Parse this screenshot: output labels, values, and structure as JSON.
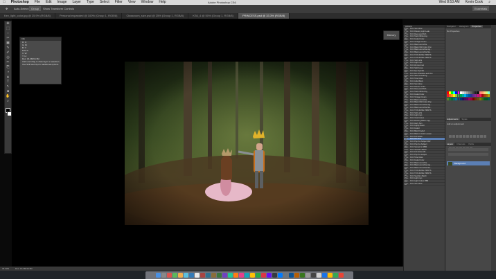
{
  "menubar": {
    "apple": "",
    "items": [
      "Photoshop",
      "File",
      "Edit",
      "Image",
      "Layer",
      "Type",
      "Select",
      "Filter",
      "View",
      "Window",
      "Help"
    ],
    "title": "Adobe Photoshop CS6",
    "clock": "Wed 8:53 AM",
    "user": "Kevin Cook"
  },
  "options": {
    "auto_select": "Auto-Select:",
    "group": "Group",
    "show_transform": "Show Transform Controls",
    "workspace": "Essentials"
  },
  "tabs": [
    {
      "label": "Kev_light_color.jpg @ 25.9% (RGB/8)",
      "active": false
    },
    {
      "label": "Personal expanded @ 100% (Group 1, RGB/8)",
      "active": false
    },
    {
      "label": "Classroom_size.psd @ 25% (Group 1, RGB/8)",
      "active": false
    },
    {
      "label": "KS6_4 @ 50% (Group 1, RGB/8)",
      "active": false
    },
    {
      "label": "PRINCESS.psd @ 33.3% (RGB/8)",
      "active": true
    }
  ],
  "tools": [
    "✚",
    "⬚",
    "◌",
    "✂",
    "▣",
    "✎",
    "✐",
    "◎",
    "✏",
    "⎘",
    "◑",
    "▲",
    "T",
    "↖",
    "■",
    "✋",
    "⌕"
  ],
  "info_panel": {
    "title": "Info",
    "rows": [
      "R:        C:",
      "G:        M:",
      "B:        Y:",
      "8-bit     K:",
      "X:        W:",
      "Y:        H:",
      "Doc: 16.3M/16.3M",
      "Click and drag to draw layer or selection.",
      "Use Shift and Opt for additional options."
    ]
  },
  "memory_button": "Memory",
  "status": {
    "zoom": "33.33%",
    "doc": "Doc: 16.3M/16.3M"
  },
  "actions_panel": {
    "title": "Actions",
    "rows": [
      {
        "label": "KCC Sun Glow",
        "sel": false
      },
      {
        "label": "KCC Dreamy Light Leak",
        "sel": false
      },
      {
        "label": "KCC Deep and Rich",
        "sel": false
      },
      {
        "label": "KCC Teeth Whitening",
        "sel": false
      },
      {
        "label": "KCC Faded Color",
        "sel": false
      },
      {
        "label": "KCC Vintage Cream",
        "sel": false
      },
      {
        "label": "KCC Black and white",
        "sel": false
      },
      {
        "label": "KCC Black With Color Pop",
        "sel": false
      },
      {
        "label": "KCC Black and white Hig...",
        "sel": false
      },
      {
        "label": "KCC Black and white Ma...",
        "sel": false
      },
      {
        "label": "KCC TR B-RUSH PRINTS",
        "sel": false
      },
      {
        "label": "KCC TR B-RUSH PRINTS",
        "sel": false
      },
      {
        "label": "KCC Soft Light",
        "sel": false
      },
      {
        "label": "KCC Light rays",
        "sel": false
      },
      {
        "label": "KCC All one level",
        "sel": false
      },
      {
        "label": "KCC Soft Focus",
        "sel": false
      },
      {
        "label": "KCC Eye Sparkle",
        "sel": false
      },
      {
        "label": "KCC Eye Shadows and Pop",
        "sel": false
      },
      {
        "label": "KCC Skin Smoothing",
        "sel": false
      },
      {
        "label": "KCC Tone Glow",
        "sel": false
      },
      {
        "label": "KCC Little Black",
        "sel": false
      },
      {
        "label": "KCC Sun Glow",
        "sel": false
      },
      {
        "label": "KCC Dreamy Light",
        "sel": false
      },
      {
        "label": "KCC Deep and Rich",
        "sel": false
      },
      {
        "label": "KCC Teeth Whitening",
        "sel": false
      },
      {
        "label": "KCC Faded Color",
        "sel": false
      },
      {
        "label": "KCC Vintage Cream",
        "sel": false
      },
      {
        "label": "KCC Black and white",
        "sel": false
      },
      {
        "label": "KCC Black With Color Pop",
        "sel": false
      },
      {
        "label": "KCC Black and white Hig...",
        "sel": false
      },
      {
        "label": "KCC Black and white Ma...",
        "sel": false
      },
      {
        "label": "KCC TR B-RUSH PRINTS",
        "sel": false
      },
      {
        "label": "KCC Soft Light",
        "sel": false
      },
      {
        "label": "KCC Light rays",
        "sel": false
      },
      {
        "label": "KCC Vivid Colour",
        "sel": false
      },
      {
        "label": "KCC Evening Batch copy",
        "sel": false
      },
      {
        "label": "KCC Hazy Sun",
        "sel": false
      },
      {
        "label": "KCC Lightly Batch",
        "sel": false
      },
      {
        "label": "KCC Faded",
        "sel": false
      },
      {
        "label": "KCC Batch Faded",
        "sel": false
      },
      {
        "label": "KCC Black & Color Lessen",
        "sel": false
      },
      {
        "label": "KCC Full Gloss",
        "sel": false
      },
      {
        "label": "KCC Kev Sun",
        "sel": true
      },
      {
        "label": "KCC Pop the Subject RW",
        "sel": false
      },
      {
        "label": "KCC Pop the Subject",
        "sel": false
      },
      {
        "label": "KCC Sunset for PBB",
        "sel": false
      },
      {
        "label": "KCC Soothing Batch",
        "sel": false
      },
      {
        "label": "KCC Full Gloss Mix",
        "sel": false
      },
      {
        "label": "KCC Pop the subject",
        "sel": false
      },
      {
        "label": "KCC Tone Glow",
        "sel": false
      },
      {
        "label": "KCC Faded Color",
        "sel": false
      },
      {
        "label": "KCC Black and white",
        "sel": false
      },
      {
        "label": "KCC Black and white Hig...",
        "sel": false
      },
      {
        "label": "KCC Black and white Ma...",
        "sel": false
      },
      {
        "label": "KCC TR B-RUSH PRINTS",
        "sel": false
      },
      {
        "label": "KCC TR B-RUSH PRINTS",
        "sel": false
      },
      {
        "label": "KCC Soothing Batch",
        "sel": false
      },
      {
        "label": "KCC Light rays",
        "sel": false
      },
      {
        "label": "KCC Light Colour PBB",
        "sel": false
      },
      {
        "label": "KCC Sun Glow",
        "sel": false
      }
    ]
  },
  "right_panels": {
    "tabs": [
      "Navigator",
      "Histogram",
      "Properties"
    ],
    "properties_text": "No Properties",
    "adjust_tabs": [
      "Adjustments",
      "Styles"
    ],
    "adjust_label": "Add an adjustment",
    "layers_tabs": [
      "Layers",
      "Channels",
      "Paths"
    ],
    "layer_name": "Background"
  },
  "colors": {
    "accent": "#5b7fb5",
    "panel": "#404040",
    "swatches": [
      "#ff0000",
      "#ffff00",
      "#00ff00",
      "#00ffff",
      "#0000ff",
      "#ff00ff",
      "#ffffff",
      "#e0e0e0",
      "#c0c0c0",
      "#a0a0a0",
      "#808080",
      "#606060",
      "#404040",
      "#202020",
      "#000000",
      "#ff8080",
      "#ff9f6a",
      "#ffd27f",
      "#c8ff7f",
      "#7fffd4",
      "#ed1c24",
      "#f26522",
      "#f7941d",
      "#fff200",
      "#8dc63f",
      "#39b54a",
      "#00a651",
      "#00a99d",
      "#00aeef",
      "#0072bc",
      "#0054a6",
      "#2e3192",
      "#662d91",
      "#92278f",
      "#ec008c",
      "#ed145b",
      "#9e0b0f",
      "#a0410d",
      "#a3620a",
      "#aba000",
      "#598527",
      "#197b30",
      "#007236",
      "#00746b",
      "#0076a3",
      "#004a80",
      "#003471",
      "#1b1464",
      "#440e62",
      "#630460",
      "#9e005d",
      "#9e0039",
      "#790000",
      "#7b2e00",
      "#7d4900",
      "#827b00",
      "#406618",
      "#005e20",
      "#005826",
      "#005952"
    ]
  }
}
